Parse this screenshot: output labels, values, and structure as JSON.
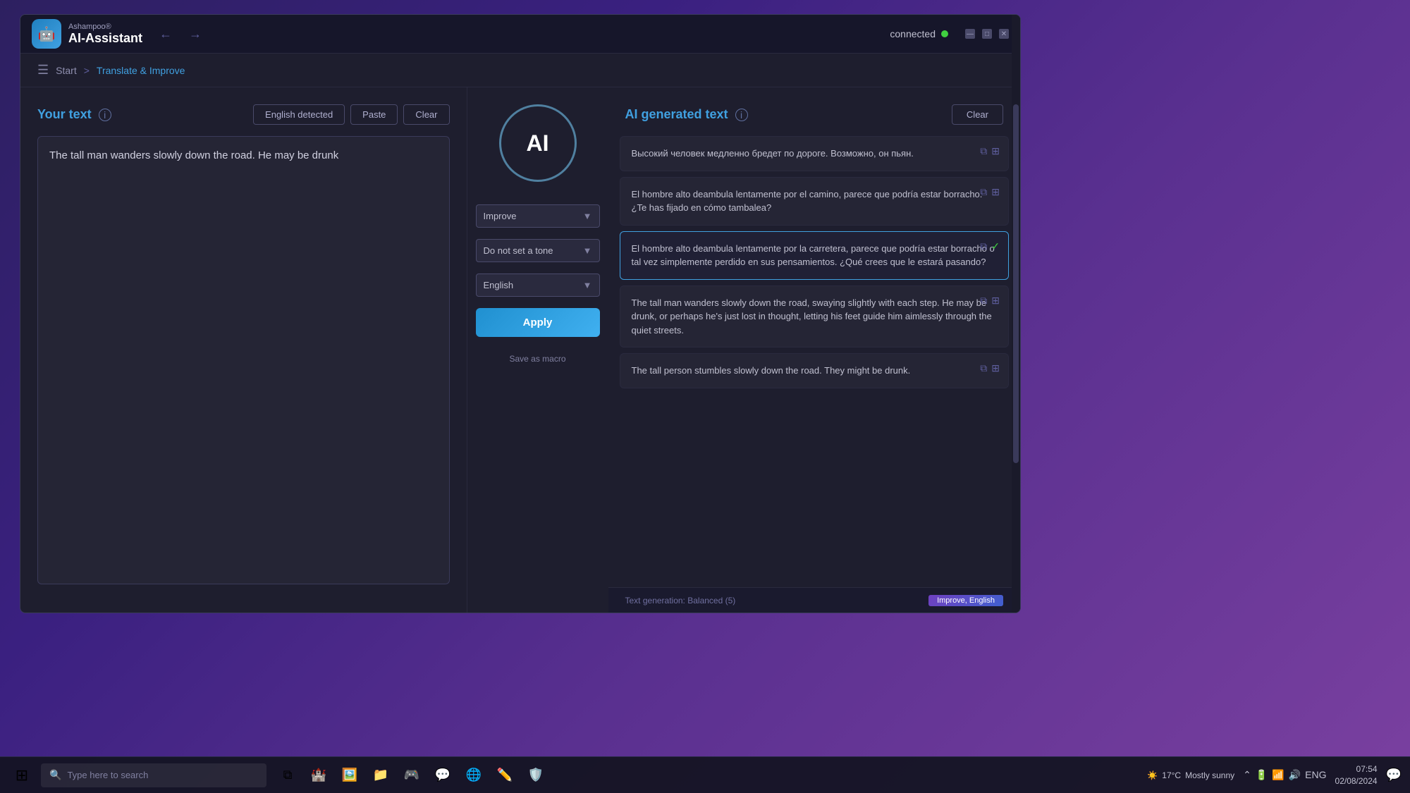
{
  "desktop": {
    "background_gradient": "linear-gradient(135deg, #2d2060, #7a40a0)"
  },
  "app": {
    "brand": "Ashampoo®",
    "name": "AI-Assistant",
    "logo_text": "🤖",
    "connection_status": "connected",
    "window_controls": [
      "—",
      "□",
      "✕"
    ]
  },
  "breadcrumb": {
    "start_label": "Start",
    "separator": ">",
    "current": "Translate & Improve"
  },
  "left_panel": {
    "title": "Your text",
    "info_tooltip": "i",
    "english_detected_label": "English detected",
    "paste_label": "Paste",
    "clear_label": "Clear",
    "input_text": "The tall man wanders slowly down the road. He may be drunk"
  },
  "middle_panel": {
    "ai_label": "AI",
    "improve_label": "Improve",
    "tone_label": "Do not set a tone",
    "language_label": "English",
    "apply_label": "Apply",
    "save_macro_label": "Save as macro"
  },
  "right_panel": {
    "title": "AI generated text",
    "info_tooltip": "i",
    "clear_label": "Clear",
    "results": [
      {
        "id": 1,
        "text": "Высокий человек медленно бредет по дороге. Возможно, он пьян.",
        "selected": false,
        "checkmark": false
      },
      {
        "id": 2,
        "text": "El hombre alto deambula lentamente por el camino, parece que podría estar borracho. ¿Te has fijado en cómo tambalea?",
        "selected": false,
        "checkmark": false
      },
      {
        "id": 3,
        "text": "El hombre alto deambula lentamente por la carretera, parece que podría estar borracho o tal vez simplemente perdido en sus pensamientos. ¿Qué crees que le estará pasando?",
        "selected": true,
        "checkmark": true
      },
      {
        "id": 4,
        "text": "The tall man wanders slowly down the road, swaying slightly with each step. He may be drunk, or perhaps he's just lost in thought, letting his feet guide him aimlessly through the quiet streets.",
        "selected": false,
        "checkmark": false
      },
      {
        "id": 5,
        "text": "The tall person stumbles slowly down the road. They might be drunk.",
        "selected": false,
        "checkmark": false
      }
    ],
    "status_text": "Text generation:  Balanced (5)",
    "status_badge": "Improve, English"
  },
  "taskbar": {
    "search_placeholder": "Type here to search",
    "weather_temp": "17°C",
    "weather_desc": "Mostly sunny",
    "time": "07:54",
    "date": "02/08/2024",
    "language": "ENG",
    "taskbar_icons": [
      "🗂",
      "📁",
      "🎮",
      "💬",
      "🌐",
      "✏️",
      "🛡️"
    ]
  }
}
